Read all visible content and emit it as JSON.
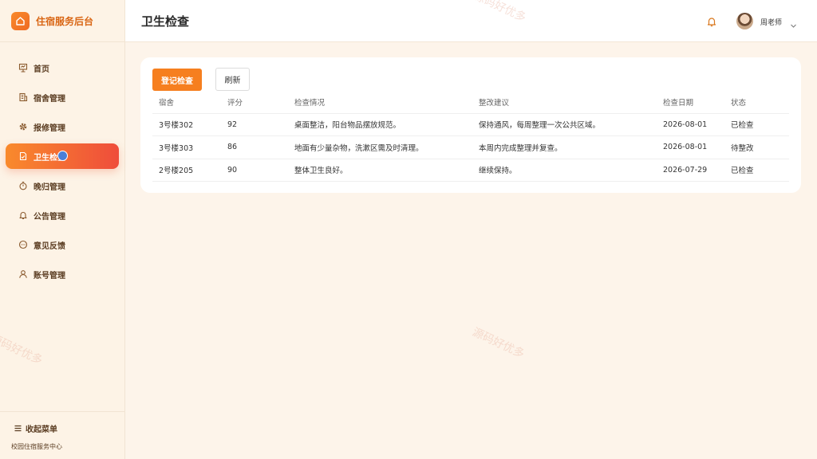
{
  "app": {
    "brand": "住宿服务后台"
  },
  "sidebar": {
    "items": [
      {
        "label": "首页",
        "icon": "presentation-icon"
      },
      {
        "label": "宿舍管理",
        "icon": "building-icon"
      },
      {
        "label": "报修管理",
        "icon": "gear-icon"
      },
      {
        "label": "卫生检查",
        "icon": "document-check-icon",
        "active": true
      },
      {
        "label": "晚归管理",
        "icon": "stopwatch-icon"
      },
      {
        "label": "公告管理",
        "icon": "bell-icon"
      },
      {
        "label": "意见反馈",
        "icon": "chat-icon"
      },
      {
        "label": "账号管理",
        "icon": "user-icon"
      }
    ],
    "collapse_label": "收起菜单",
    "footer": "校园住宿服务中心"
  },
  "header": {
    "title": "卫生检查",
    "user_name": "周老师"
  },
  "toolbar": {
    "register_label": "登记检查",
    "refresh_label": "刷新"
  },
  "table": {
    "columns": [
      "宿舍",
      "评分",
      "检查情况",
      "整改建议",
      "检查日期",
      "状态"
    ],
    "rows": [
      [
        "3号楼302",
        "92",
        "桌面整洁，阳台物品摆放规范。",
        "保持通风，每周整理一次公共区域。",
        "2026-08-01",
        "已检查"
      ],
      [
        "3号楼303",
        "86",
        "地面有少量杂物，洗漱区需及时清理。",
        "本周内完成整理并复查。",
        "2026-08-01",
        "待整改"
      ],
      [
        "2号楼205",
        "90",
        "整体卫生良好。",
        "继续保持。",
        "2026-07-29",
        "已检查"
      ]
    ]
  },
  "watermark": "源码好优多",
  "colors": {
    "accent": "#f67f1f",
    "active_gradient_end": "#ef4d3b",
    "background": "#fdf4ea"
  }
}
